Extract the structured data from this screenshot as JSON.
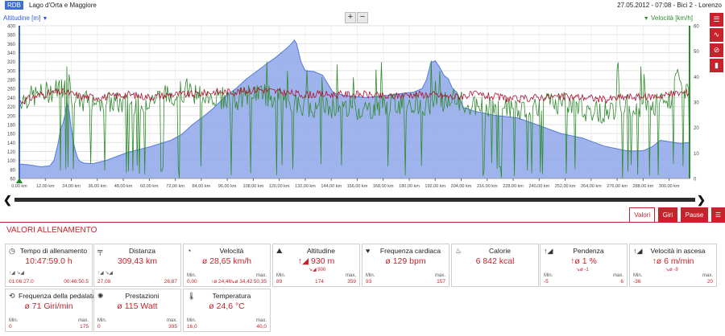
{
  "header": {
    "badge": "RDB",
    "track": "Lago d'Orta e Maggiore",
    "meta": "27.05.2012  -  07:08  -  Bici 2  -  Lorenzo"
  },
  "axes": {
    "left_title": "Altitudine [m]",
    "right_title": "Velocità [km/h]"
  },
  "zoom": {
    "in": "+",
    "out": "−"
  },
  "side_buttons": [
    "list-icon",
    "line-chart-icon",
    "slash-circle-icon",
    "bar-chart-icon"
  ],
  "colors": {
    "altitude_fill": "#8fa8ea",
    "altitude_line": "#3a63d6",
    "speed": "#2e8b2e",
    "heart": "#b01030",
    "accent": "#c8232c"
  },
  "tabs": {
    "valori": "Valori",
    "giri": "Giri",
    "pause": "Pause"
  },
  "panel_title": "VALORI ALLENAMENTO",
  "cards": [
    {
      "icon": "clock-icon",
      "glyph": "◷",
      "title": "Tempo di allenamento",
      "value": "10:47:59.0 h",
      "sub": "↑◢  ↘◢",
      "left": "01:06:27.0",
      "right": "00:46:50.5"
    },
    {
      "icon": "road-icon",
      "glyph": "╤",
      "title": "Distanza",
      "value": "309,43 km",
      "sub": "↑◢  ↘◢",
      "left": "27,08",
      "right": "26,87"
    },
    {
      "icon": "speedometer-icon",
      "glyph": "◔",
      "title": "Velocità",
      "value": "ø 28,65 km/h",
      "sub": "",
      "lbl_min": "Min.",
      "lbl_max": "max.",
      "left": "0,00",
      "m1": "↑ø 24,46",
      "m2": "↘ø 34,42",
      "right": "50,35"
    },
    {
      "icon": "mountain-icon",
      "glyph": "⛰",
      "title": "Altitudine",
      "value": "↑◢ 930 m",
      "value2": "↘◢ 900",
      "lbl_min": "Min.",
      "lbl_max": "max.",
      "left": "89",
      "mid": "174",
      "right": "359"
    },
    {
      "icon": "heart-icon",
      "glyph": "♥",
      "title": "Frequenza cardiaca",
      "value": "ø 129 bpm",
      "lbl_min": "Min.",
      "lbl_max": "max.",
      "left": "93",
      "right": "157"
    },
    {
      "icon": "flame-icon",
      "glyph": "♨",
      "title": "Calorie",
      "value": "6 842 kcal"
    },
    {
      "icon": "slope-icon",
      "glyph": "↑◢",
      "title": "Pendenza",
      "value": "↑ø 1 %",
      "value2": "↘ø -1",
      "lbl_min": "Min.",
      "lbl_max": "max.",
      "left": "-5",
      "right": "6"
    },
    {
      "icon": "climb-rate-icon",
      "glyph": "↑◢",
      "title": "Velocità in ascesa",
      "value": "↑ø 6 m/min",
      "value2": "↘ø -9",
      "lbl_min": "Min.",
      "lbl_max": "max.",
      "left": "-36",
      "right": "20"
    },
    {
      "icon": "cadence-icon",
      "glyph": "⟲",
      "title": "Frequenza della pedalata",
      "value": "ø 71 Giri/min",
      "lbl_min": "Min.",
      "lbl_max": "max.",
      "left": "0",
      "right": "175"
    },
    {
      "icon": "power-icon",
      "glyph": "✺",
      "title": "Prestazioni",
      "value": "ø 115 Watt",
      "lbl_min": "Min.",
      "lbl_max": "max.",
      "left": "0",
      "right": "395"
    },
    {
      "icon": "thermometer-icon",
      "glyph": "🌡",
      "title": "Temperatura",
      "value": "ø 24,6 °C",
      "lbl_min": "Min.",
      "lbl_max": "max.",
      "left": "16,0",
      "right": "40,0"
    }
  ],
  "chart_data": {
    "type": "area",
    "xlabel": "",
    "ylabel": "Altitudine [m]",
    "y2label": "Velocità [km/h]",
    "xlim": [
      0,
      309.43
    ],
    "ylim": [
      60,
      400
    ],
    "y2lim": [
      0,
      60
    ],
    "x_ticks": [
      "0,00 km",
      "12,00 km",
      "24,00 km",
      "36,00 km",
      "48,00 km",
      "60,00 km",
      "72,00 km",
      "84,00 km",
      "96,00 km",
      "108,00 km",
      "120,00 km",
      "132,00 km",
      "144,00 km",
      "156,00 km",
      "168,00 km",
      "180,00 km",
      "192,00 km",
      "204,00 km",
      "216,00 km",
      "228,00 km",
      "240,00 km",
      "252,00 km",
      "264,00 km",
      "276,00 km",
      "288,00 km",
      "300,00 km"
    ],
    "x_tick_values": [
      0,
      12,
      24,
      36,
      48,
      60,
      72,
      84,
      96,
      108,
      120,
      132,
      144,
      156,
      168,
      180,
      192,
      204,
      216,
      228,
      240,
      252,
      264,
      276,
      288,
      300
    ],
    "y_ticks": [
      60,
      80,
      100,
      120,
      140,
      160,
      180,
      200,
      220,
      240,
      260,
      280,
      300,
      320,
      340,
      360,
      380,
      400
    ],
    "y2_ticks": [
      0,
      10,
      20,
      30,
      40,
      50,
      60
    ],
    "series": [
      {
        "name": "Altitudine [m]",
        "axis": "left",
        "x": [
          0,
          5,
          10,
          14,
          16,
          18,
          19,
          20,
          21,
          22,
          23,
          24,
          25,
          26,
          27,
          28,
          30,
          34,
          40,
          50,
          60,
          70,
          75,
          80,
          85,
          90,
          95,
          100,
          105,
          110,
          115,
          118,
          120,
          122,
          124,
          126,
          127,
          128,
          129,
          130,
          132,
          136,
          140,
          145,
          150,
          160,
          170,
          178,
          182,
          186,
          188,
          190,
          192,
          194,
          196,
          198,
          200,
          202,
          205,
          210,
          220,
          230,
          240,
          250,
          260,
          270,
          280,
          284,
          288,
          292,
          296,
          300,
          305,
          309.43
        ],
        "values": [
          92,
          90,
          86,
          88,
          100,
          140,
          170,
          180,
          200,
          230,
          210,
          170,
          140,
          120,
          105,
          98,
          94,
          93,
          100,
          118,
          130,
          145,
          158,
          180,
          198,
          218,
          242,
          260,
          282,
          300,
          318,
          328,
          336,
          344,
          352,
          362,
          368,
          360,
          340,
          320,
          300,
          298,
          290,
          250,
          245,
          240,
          245,
          250,
          252,
          260,
          280,
          318,
          322,
          308,
          290,
          282,
          260,
          252,
          218,
          210,
          200,
          195,
          178,
          160,
          150,
          132,
          122,
          121,
          122,
          130,
          145,
          142,
          138,
          140
        ]
      },
      {
        "name": "Velocità [km/h]",
        "axis": "right",
        "x": [
          0,
          10,
          20,
          22,
          24,
          26,
          28,
          30,
          40,
          50,
          60,
          70,
          80,
          90,
          100,
          110,
          120,
          130,
          140,
          150,
          160,
          170,
          180,
          190,
          200,
          210,
          220,
          230,
          240,
          250,
          260,
          270,
          280,
          290,
          300,
          305,
          309.43
        ],
        "values": [
          31,
          33,
          36,
          45,
          32,
          30,
          28,
          31,
          30,
          29,
          31,
          33,
          34,
          32,
          31,
          34,
          31,
          29,
          28,
          28,
          27,
          29,
          30,
          29,
          31,
          28,
          28,
          27,
          29,
          30,
          27,
          26,
          29,
          28,
          30,
          42,
          30
        ],
        "note": ""
      },
      {
        "name": "",
        "axis": "right",
        "x": [
          0,
          10,
          20,
          30,
          40,
          50,
          60,
          70,
          80,
          90,
          100,
          110,
          120,
          130,
          140,
          150,
          160,
          170,
          180,
          190,
          200,
          210,
          220,
          230,
          240,
          250,
          260,
          270,
          280,
          290,
          300,
          309.43
        ],
        "values": [
          30,
          33,
          34,
          32,
          32,
          33,
          32,
          33,
          33,
          34,
          34,
          35,
          34,
          33,
          33,
          33,
          33,
          32,
          33,
          33,
          32,
          33,
          32,
          31,
          32,
          32,
          32,
          31,
          32,
          32,
          33,
          34
        ]
      }
    ],
    "grid": true
  }
}
